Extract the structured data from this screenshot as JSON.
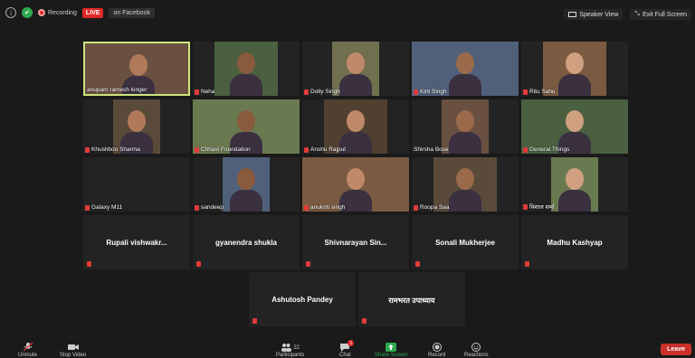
{
  "topbar": {
    "recording_label": "Recording",
    "live_label": "LIVE",
    "live_dest": "on Facebook",
    "speaker_view": "Speaker View",
    "exit_fullscreen": "Exit Full Screen"
  },
  "participants": [
    {
      "name": "anupam ramesh kinger",
      "video": true,
      "muted": false
    },
    {
      "name": "Neha",
      "video": true,
      "muted": true
    },
    {
      "name": "Dolly Singh",
      "video": true,
      "muted": true
    },
    {
      "name": "Kirti Singh",
      "video": true,
      "muted": true
    },
    {
      "name": "Ritu Sahu",
      "video": true,
      "muted": true
    },
    {
      "name": "Khushboo Sharma",
      "video": true,
      "muted": true
    },
    {
      "name": "Chhavi Foundation",
      "video": true,
      "muted": true
    },
    {
      "name": "Anshu Rajput",
      "video": true,
      "muted": true
    },
    {
      "name": "Shirsha Bose",
      "video": true,
      "muted": false
    },
    {
      "name": "General Things",
      "video": true,
      "muted": true
    },
    {
      "name": "Galaxy M11",
      "video": false,
      "muted": true
    },
    {
      "name": "sandeep",
      "video": true,
      "muted": true
    },
    {
      "name": "anukriti singh",
      "video": true,
      "muted": true
    },
    {
      "name": "Roopa Saa",
      "video": true,
      "muted": true
    },
    {
      "name": "विशाल शर्मा",
      "video": true,
      "muted": true
    },
    {
      "name": "Rupali vishwakr...",
      "video": false,
      "muted": true
    },
    {
      "name": "gyanendra shukla",
      "video": false,
      "muted": true
    },
    {
      "name": "Shivnarayan Sin...",
      "video": false,
      "muted": true
    },
    {
      "name": "Sonali Mukherjee",
      "video": false,
      "muted": true
    },
    {
      "name": "Madhu Kashyap",
      "video": false,
      "muted": true
    },
    {
      "name": "Ashutosh Pandey",
      "video": false,
      "muted": true
    },
    {
      "name": "रामभरत उपाध्याय",
      "video": false,
      "muted": true
    }
  ],
  "toolbar": {
    "unmute": "Unmute",
    "stop_video": "Stop Video",
    "participants": "Participants",
    "participants_count": "22",
    "chat": "Chat",
    "chat_badge": "1",
    "share_screen": "Share Screen",
    "record": "Record",
    "reactions": "Reactions",
    "leave": "Leave"
  },
  "colors": {
    "background": "#1a1a1a",
    "tile": "#232323",
    "active_border": "#cde47a",
    "live_red": "#e02828",
    "share_green": "#2fa84f",
    "leave_red": "#c9302c"
  }
}
